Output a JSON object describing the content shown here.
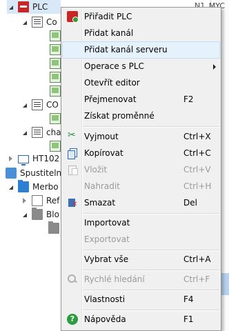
{
  "tree": {
    "items": [
      {
        "label": "PLC",
        "icon": "plc-icon"
      },
      {
        "label": "Co"
      },
      {
        "label": "CO"
      },
      {
        "label": "cha"
      },
      {
        "label": "HT102"
      },
      {
        "label": "Spustitelné"
      },
      {
        "label": "Merbo"
      },
      {
        "label": "Ref"
      },
      {
        "label": "Blo"
      }
    ]
  },
  "right_strip": {
    "top_text": "N1_MYC",
    "row_letter": "C"
  },
  "context_menu": {
    "items": [
      {
        "label": "Přiřadit PLC",
        "shortcut": "",
        "icon": "assign-plc-icon",
        "disabled": false
      },
      {
        "label": "Přidat kanál",
        "shortcut": "",
        "disabled": false
      },
      {
        "label": "Přidat kanál serveru",
        "shortcut": "",
        "disabled": false,
        "hover": true
      },
      {
        "label": "Operace s PLC",
        "shortcut": "",
        "disabled": false,
        "submenu": true
      },
      {
        "label": "Otevřít editor",
        "shortcut": "",
        "disabled": false
      },
      {
        "label": "Přejmenovat",
        "shortcut": "F2",
        "disabled": false
      },
      {
        "label": "Získat proměnné",
        "shortcut": "",
        "disabled": false
      },
      {
        "label": "Vyjmout",
        "shortcut": "Ctrl+X",
        "icon": "cut-icon",
        "disabled": false
      },
      {
        "label": "Kopírovat",
        "shortcut": "Ctrl+C",
        "icon": "copy-icon",
        "disabled": false
      },
      {
        "label": "Vložit",
        "shortcut": "Ctrl+V",
        "icon": "paste-icon",
        "disabled": true
      },
      {
        "label": "Nahradit",
        "shortcut": "Ctrl+H",
        "disabled": true
      },
      {
        "label": "Smazat",
        "shortcut": "Del",
        "icon": "delete-icon",
        "disabled": false
      },
      {
        "label": "Importovat",
        "shortcut": "",
        "disabled": false
      },
      {
        "label": "Exportovat",
        "shortcut": "",
        "disabled": true
      },
      {
        "label": "Vybrat vše",
        "shortcut": "Ctrl+A",
        "disabled": false
      },
      {
        "label": "Rychlé hledání",
        "shortcut": "Ctrl+F",
        "icon": "search-icon",
        "disabled": true
      },
      {
        "label": "Vlastnosti",
        "shortcut": "F4",
        "disabled": false
      },
      {
        "label": "Nápověda",
        "shortcut": "F1",
        "icon": "help-icon",
        "disabled": false
      }
    ]
  }
}
